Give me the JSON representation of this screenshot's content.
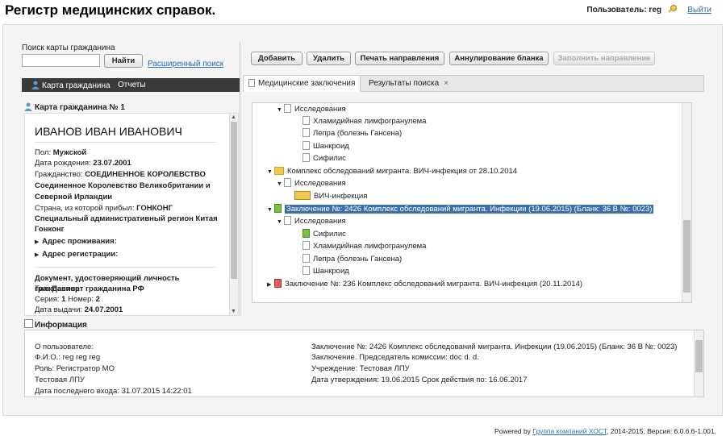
{
  "header": {
    "title": "Регистр медицинских справок.",
    "user_label": "Пользователь: reg",
    "logout": "Выйти"
  },
  "search": {
    "label": "Поиск карты гражданина",
    "value": "",
    "find_button": "Найти",
    "advanced_link": "Расширенный поиск"
  },
  "toolbar": {
    "add": "Добавить",
    "delete": "Удалить",
    "print": "Печать направления",
    "cancel_form": "Аннулирование бланка",
    "fill": "Заполнить направление"
  },
  "left_nav": {
    "card": "Карта гражданина",
    "reports": "Отчеты"
  },
  "card": {
    "header": "Карта гражданина № 1",
    "fio": "ИВАНОВ ИВАН ИВАНОВИЧ",
    "sex_label": "Пол:",
    "sex": "Мужской",
    "dob_label": "Дата рождения:",
    "dob": "23.07.2001",
    "citizenship_label": "Гражданство:",
    "citizenship_1": "СОЕДИНЕННОЕ КОРОЛЕВСТВО",
    "citizenship_2": "Соединенное Королевство Великобритании и",
    "citizenship_3": "Северной Ирландии",
    "country_label": "Страна, из которой прибыл:",
    "country": "ГОНКОНГ",
    "region_1": "Специальный административный регион Китая",
    "region_2": "Гонконг",
    "address_res": "Адрес проживания:",
    "address_reg": "Адрес регистрации:",
    "doc_title": "Документ, удостоверяющий личность гражданина",
    "doc_type_label": "Тип:",
    "doc_type": "Паспорт гражданина РФ",
    "series_label": "Серия:",
    "series": "1",
    "number_label": "Номер:",
    "number": "2",
    "issue_label": "Дата выдачи:",
    "issue": "24.07.2001"
  },
  "tabs": {
    "med": "Медицинские заключения",
    "results": "Результаты поиска"
  },
  "tree": [
    "Исследования",
    "Хламидийная лимфогранулема",
    "Лепра (болезнь Гансена)",
    "Шанкроид",
    "Сифилис",
    "Комплекс обследований мигранта. ВИЧ-инфекция от 28.10.2014",
    "Исследования",
    "ВИЧ-инфекция",
    "Заключение №: 2426 Комплекс обследований мигранта. Инфекции (19.06.2015) (Бланк: 36 В №: 0023)",
    "Исследования",
    "Сифилис",
    "Хламидийная лимфогранулема",
    "Лепра (болезнь Гансена)",
    "Шанкроид",
    "Заключение №: 236 Комплекс обследований мигранта. ВИЧ-инфекция (20.11.2014)"
  ],
  "info": {
    "header": "Информация",
    "left": [
      "О пользователе:",
      "Ф.И.О.: reg reg reg",
      "Роль: Регистратор МО",
      "Тестовая ЛПУ",
      "Дата последнего входа: 31.07.2015 14:22:01"
    ],
    "right": [
      "Заключение №: 2426 Комплекс обследований мигранта. Инфекции (19.06.2015) (Бланк: 36 В №: 0023)",
      "Заключение. Председатель комиссии: doc d. d.",
      "Учреждение: Тестовая ЛПУ",
      "Дата утверждения: 19.06.2015 Срок действия по: 16.06.2017"
    ]
  },
  "footer": {
    "powered": "Powered by",
    "company": "Группа компаний ХОСТ",
    "rest": ", 2014-2015. Версия: 6.0.6.6-1.001."
  },
  "colors": {
    "accent": "#2a6db0",
    "selection": "#3d6fa8",
    "nav_bg": "#3a3a3a"
  }
}
